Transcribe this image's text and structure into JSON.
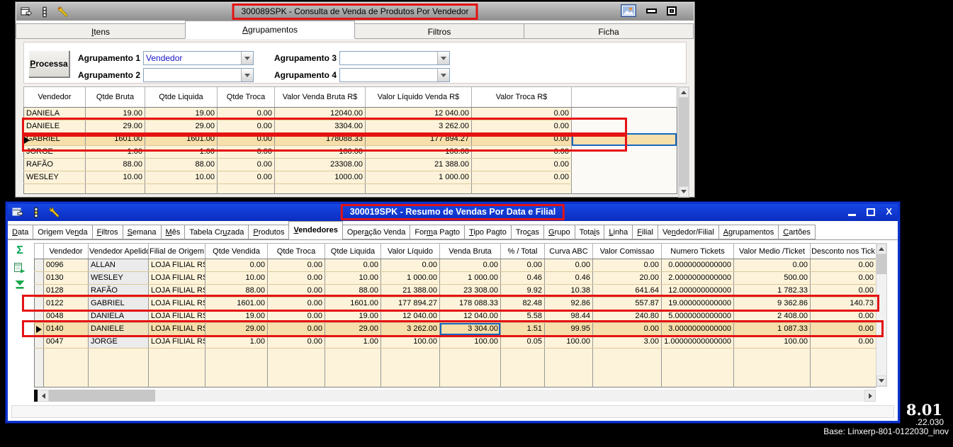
{
  "window1": {
    "title": "300089SPK - Consulta de Venda de Produtos Por Vendedor",
    "tabs": [
      {
        "label": "Itens",
        "underline": 0,
        "active": false
      },
      {
        "label": "Agrupamentos",
        "underline": 0,
        "active": true
      },
      {
        "label": "Filtros",
        "underline": null,
        "active": false
      },
      {
        "label": "Ficha",
        "underline": null,
        "active": false
      }
    ],
    "panel": {
      "process_button": "Processa",
      "process_underline": 0,
      "fields": [
        {
          "label": "Agrupamento 1",
          "value": "Vendedor"
        },
        {
          "label": "Agrupamento 2",
          "value": ""
        },
        {
          "label": "Agrupamento 3",
          "value": ""
        },
        {
          "label": "Agrupamento 4",
          "value": ""
        }
      ]
    },
    "grid": {
      "columns": [
        "Vendedor",
        "Qtde Bruta",
        "Qtde Liquida",
        "Qtde Troca",
        "Valor Venda Bruta R$",
        "Valor Líquido Venda R$",
        "Valor Troca R$",
        ""
      ],
      "rows": [
        [
          "DANIELA",
          "19.00",
          "19.00",
          "0.00",
          "12040.00",
          "12 040.00",
          "0.00",
          ""
        ],
        [
          "DANIELE",
          "29.00",
          "29.00",
          "0.00",
          "3304.00",
          "3 262.00",
          "0.00",
          ""
        ],
        [
          "GABRIEL",
          "1601.00",
          "1601.00",
          "0.00",
          "178088.33",
          "177 894.27",
          "0.00",
          ""
        ],
        [
          "JORGE",
          "1.00",
          "1.00",
          "0.00",
          "100.00",
          "100.00",
          "0.00",
          ""
        ],
        [
          "RAFÃO",
          "88.00",
          "88.00",
          "0.00",
          "23308.00",
          "21 388.00",
          "0.00",
          ""
        ],
        [
          "WESLEY",
          "10.00",
          "10.00",
          "0.00",
          "1000.00",
          "1 000.00",
          "0.00",
          ""
        ]
      ],
      "selected_row": 2,
      "focused_cell": {
        "row": 2,
        "col": 7
      }
    }
  },
  "window2": {
    "title": "300019SPK - Resumo de Vendas Por Data e Filial",
    "tabs": [
      {
        "label": "Data",
        "underline": 0,
        "active": false
      },
      {
        "label": "Origem Venda",
        "underline": 9,
        "active": false
      },
      {
        "label": "Filtros",
        "underline": 0,
        "active": false
      },
      {
        "label": "Semana",
        "underline": 0,
        "active": false
      },
      {
        "label": "Mês",
        "underline": 0,
        "active": false
      },
      {
        "label": "Tabela Cruzada",
        "underline": 9,
        "active": false
      },
      {
        "label": "Produtos",
        "underline": 0,
        "active": false
      },
      {
        "label": "Vendedores",
        "underline": 0,
        "active": true
      },
      {
        "label": "Operação Venda",
        "underline": 4,
        "active": false
      },
      {
        "label": "Forma Pagto",
        "underline": 3,
        "active": false
      },
      {
        "label": "Tipo Pagto",
        "underline": 0,
        "active": false
      },
      {
        "label": "Trocas",
        "underline": 3,
        "active": false
      },
      {
        "label": "Grupo",
        "underline": 0,
        "active": false
      },
      {
        "label": "Totais",
        "underline": 4,
        "active": false
      },
      {
        "label": "Linha",
        "underline": 0,
        "active": false
      },
      {
        "label": "Filial",
        "underline": 0,
        "active": false
      },
      {
        "label": "Vendedor/Filial",
        "underline": 2,
        "active": false
      },
      {
        "label": "Agrupamentos",
        "underline": 0,
        "active": false
      },
      {
        "label": "Cartões",
        "underline": 0,
        "active": false
      }
    ],
    "toolbar": {
      "sigma_glyph": "Σ",
      "icons": [
        "sigma-icon",
        "export-icon",
        "filter-icon"
      ]
    },
    "grid": {
      "columns": [
        "Vendedor",
        "Vendedor Apelido",
        "Filial de Origem",
        "Qtde Vendida",
        "Qtde Troca",
        "Qtde Liquida",
        "Valor Líquido",
        "Venda Bruta",
        "% / Total",
        "Curva ABC",
        "Valor Comissao",
        "Numero Tickets",
        "Valor Medio /Ticket",
        "Desconto nos Tick"
      ],
      "rows": [
        [
          "0096",
          "ALLAN",
          "LOJA FILIAL RS",
          "0.00",
          "0.00",
          "0.00",
          "0.00",
          "0.00",
          "0.00",
          "0.00",
          "0.00",
          "0.0000000000000",
          "0.00",
          "0.00"
        ],
        [
          "0130",
          "WESLEY",
          "LOJA FILIAL RS",
          "10.00",
          "0.00",
          "10.00",
          "1 000.00",
          "1 000.00",
          "0.46",
          "0.46",
          "20.00",
          "2.0000000000000",
          "500.00",
          "0.00"
        ],
        [
          "0128",
          "RAFÃO",
          "LOJA FILIAL RS",
          "88.00",
          "0.00",
          "88.00",
          "21 388.00",
          "23 308.00",
          "9.92",
          "10.38",
          "641.64",
          "12.000000000000",
          "1 782.33",
          "0.00"
        ],
        [
          "0122",
          "GABRIEL",
          "LOJA FILIAL RS",
          "1601.00",
          "0.00",
          "1601.00",
          "177 894.27",
          "178 088.33",
          "82.48",
          "92.86",
          "557.87",
          "19.000000000000",
          "9 362.86",
          "140.73"
        ],
        [
          "0048",
          "DANIELA",
          "LOJA FILIAL RS",
          "19.00",
          "0.00",
          "19.00",
          "12 040.00",
          "12 040.00",
          "5.58",
          "98.44",
          "240.80",
          "5.0000000000000",
          "2 408.00",
          "0.00"
        ],
        [
          "0140",
          "DANIELE",
          "LOJA FILIAL RS",
          "29.00",
          "0.00",
          "29.00",
          "3 262.00",
          "3 304.00",
          "1.51",
          "99.95",
          "0.00",
          "3.0000000000000",
          "1 087.33",
          "0.00"
        ],
        [
          "0047",
          "JORGE",
          "LOJA FILIAL RS",
          "1.00",
          "0.00",
          "1.00",
          "100.00",
          "100.00",
          "0.05",
          "100.00",
          "3.00",
          "1.00000000000000",
          "100.00",
          "0.00"
        ]
      ],
      "selected_row": 5,
      "focused_cell": {
        "row": 5,
        "col": 7
      }
    }
  },
  "footer": {
    "version_large": "8.01",
    "version_small": ".22.030",
    "base_label": "Base: Linxerp-801-0122030_inov"
  },
  "colors": {
    "annotation_red": "#e51212",
    "titlebar_blue": "#0d35cf",
    "row_cream": "#fdf3da",
    "row_selected": "#f6dfab",
    "focus_blue": "#1767c0",
    "accent_green": "#00a651"
  }
}
